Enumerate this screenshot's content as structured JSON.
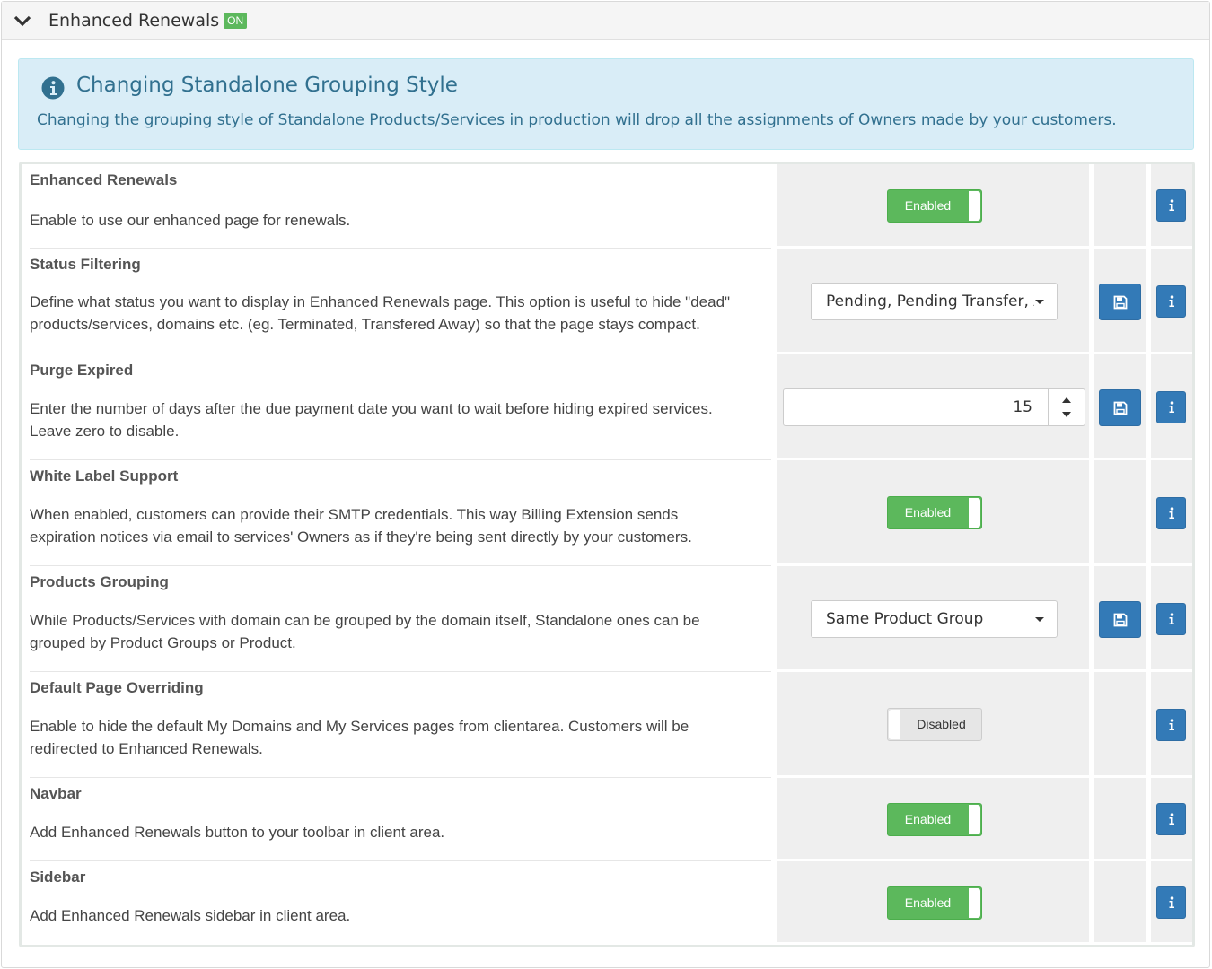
{
  "panel": {
    "title": "Enhanced Renewals",
    "badge": "ON"
  },
  "alert": {
    "title": "Changing Standalone Grouping Style",
    "text": "Changing the grouping style of Standalone Products/Services in production will drop all the assignments of Owners made by your customers."
  },
  "settings": [
    {
      "title": "Enhanced Renewals",
      "desc1": "Enable to use our enhanced page for renewals.",
      "desc2": "",
      "control": "toggle",
      "value": "Enabled",
      "has_save": false
    },
    {
      "title": "Status Filtering",
      "desc1": "Define what status you want to display in Enhanced Renewals page. This option is useful to hide \"dead\"",
      "desc2": "products/services, domains etc. (eg. Terminated, Transfered Away) so that the page stays compact.",
      "control": "select",
      "value": "Pending, Pending Transfer, Active",
      "has_save": true
    },
    {
      "title": "Purge Expired",
      "desc1": "Enter the number of days after the due payment date you want to wait before hiding expired services.",
      "desc2": "Leave zero to disable.",
      "control": "number",
      "value": "15",
      "has_save": true
    },
    {
      "title": "White Label Support",
      "desc1": "When enabled, customers can provide their SMTP credentials. This way Billing Extension sends",
      "desc2": "expiration notices via email to services' Owners as if they're being sent directly by your customers.",
      "control": "toggle",
      "value": "Enabled",
      "has_save": false
    },
    {
      "title": "Products Grouping",
      "desc1": "While Products/Services with domain can be grouped by the domain itself, Standalone ones can be",
      "desc2": "grouped by Product Groups or Product.",
      "control": "select",
      "value": "Same Product Group",
      "has_save": true
    },
    {
      "title": "Default Page Overriding",
      "desc1": "Enable to hide the default My Domains and My Services pages from clientarea. Customers will be",
      "desc2": "redirected to Enhanced Renewals.",
      "control": "toggle",
      "value": "Disabled",
      "has_save": false
    },
    {
      "title": "Navbar",
      "desc1": "Add Enhanced Renewals button to your toolbar in client area.",
      "desc2": "",
      "control": "toggle",
      "value": "Enabled",
      "has_save": false
    },
    {
      "title": "Sidebar",
      "desc1": "Add Enhanced Renewals sidebar in client area.",
      "desc2": "",
      "control": "toggle",
      "value": "Enabled",
      "has_save": false
    }
  ],
  "icons": {
    "collapse": "chevron-down-icon",
    "alert": "info-circle-icon",
    "save": "floppy-disk-icon",
    "info": "info-icon"
  },
  "colors": {
    "success": "#5cb85c",
    "primary": "#337ab7",
    "alert_bg": "#d9edf7",
    "alert_text": "#31708f"
  }
}
